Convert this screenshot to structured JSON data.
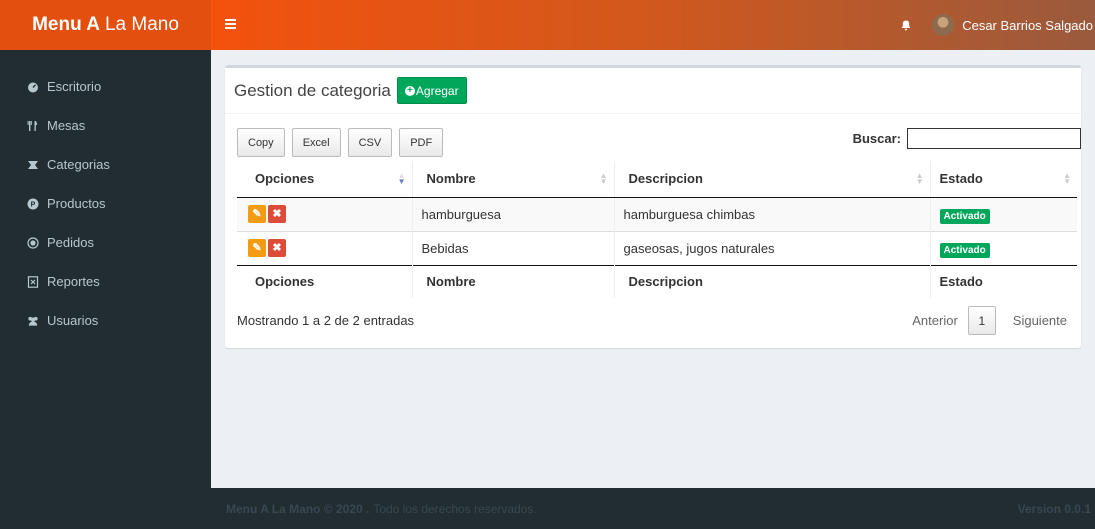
{
  "app": {
    "logo_bold": "Menu A",
    "logo_rest": "La Mano"
  },
  "header": {
    "user_name": "Cesar Barrios Salgado"
  },
  "sidebar": {
    "items": [
      {
        "label": "Escritorio",
        "icon": "dashboard-icon"
      },
      {
        "label": "Mesas",
        "icon": "cutlery-icon"
      },
      {
        "label": "Categorias",
        "icon": "category-icon"
      },
      {
        "label": "Productos",
        "icon": "product-icon"
      },
      {
        "label": "Pedidos",
        "icon": "order-icon"
      },
      {
        "label": "Reportes",
        "icon": "report-icon"
      },
      {
        "label": "Usuarios",
        "icon": "users-icon"
      }
    ]
  },
  "main": {
    "title": "Gestion de categoria",
    "add_button": "Agregar",
    "export_buttons": [
      "Copy",
      "Excel",
      "CSV",
      "PDF"
    ],
    "search_label": "Buscar:",
    "columns": [
      "Opciones",
      "Nombre",
      "Descripcion",
      "Estado"
    ],
    "rows": [
      {
        "nombre": "hamburguesa",
        "descripcion": "hamburguesa chimbas",
        "estado": "Activado"
      },
      {
        "nombre": "Bebidas",
        "descripcion": "gaseosas, jugos naturales",
        "estado": "Activado"
      }
    ],
    "info": "Mostrando 1 a 2 de 2 entradas",
    "pagination": {
      "prev": "Anterior",
      "current": "1",
      "next": "Siguiente"
    }
  },
  "footer": {
    "brand": "Menu A La Mano © 2020 .",
    "rights": "Todo los derechos reservados.",
    "version": "Version 0.0.1"
  },
  "colors": {
    "accent": "#e24f0e",
    "success": "#00a65a",
    "warning": "#f39c12",
    "danger": "#dd4b39",
    "sidebar": "#222d32"
  }
}
